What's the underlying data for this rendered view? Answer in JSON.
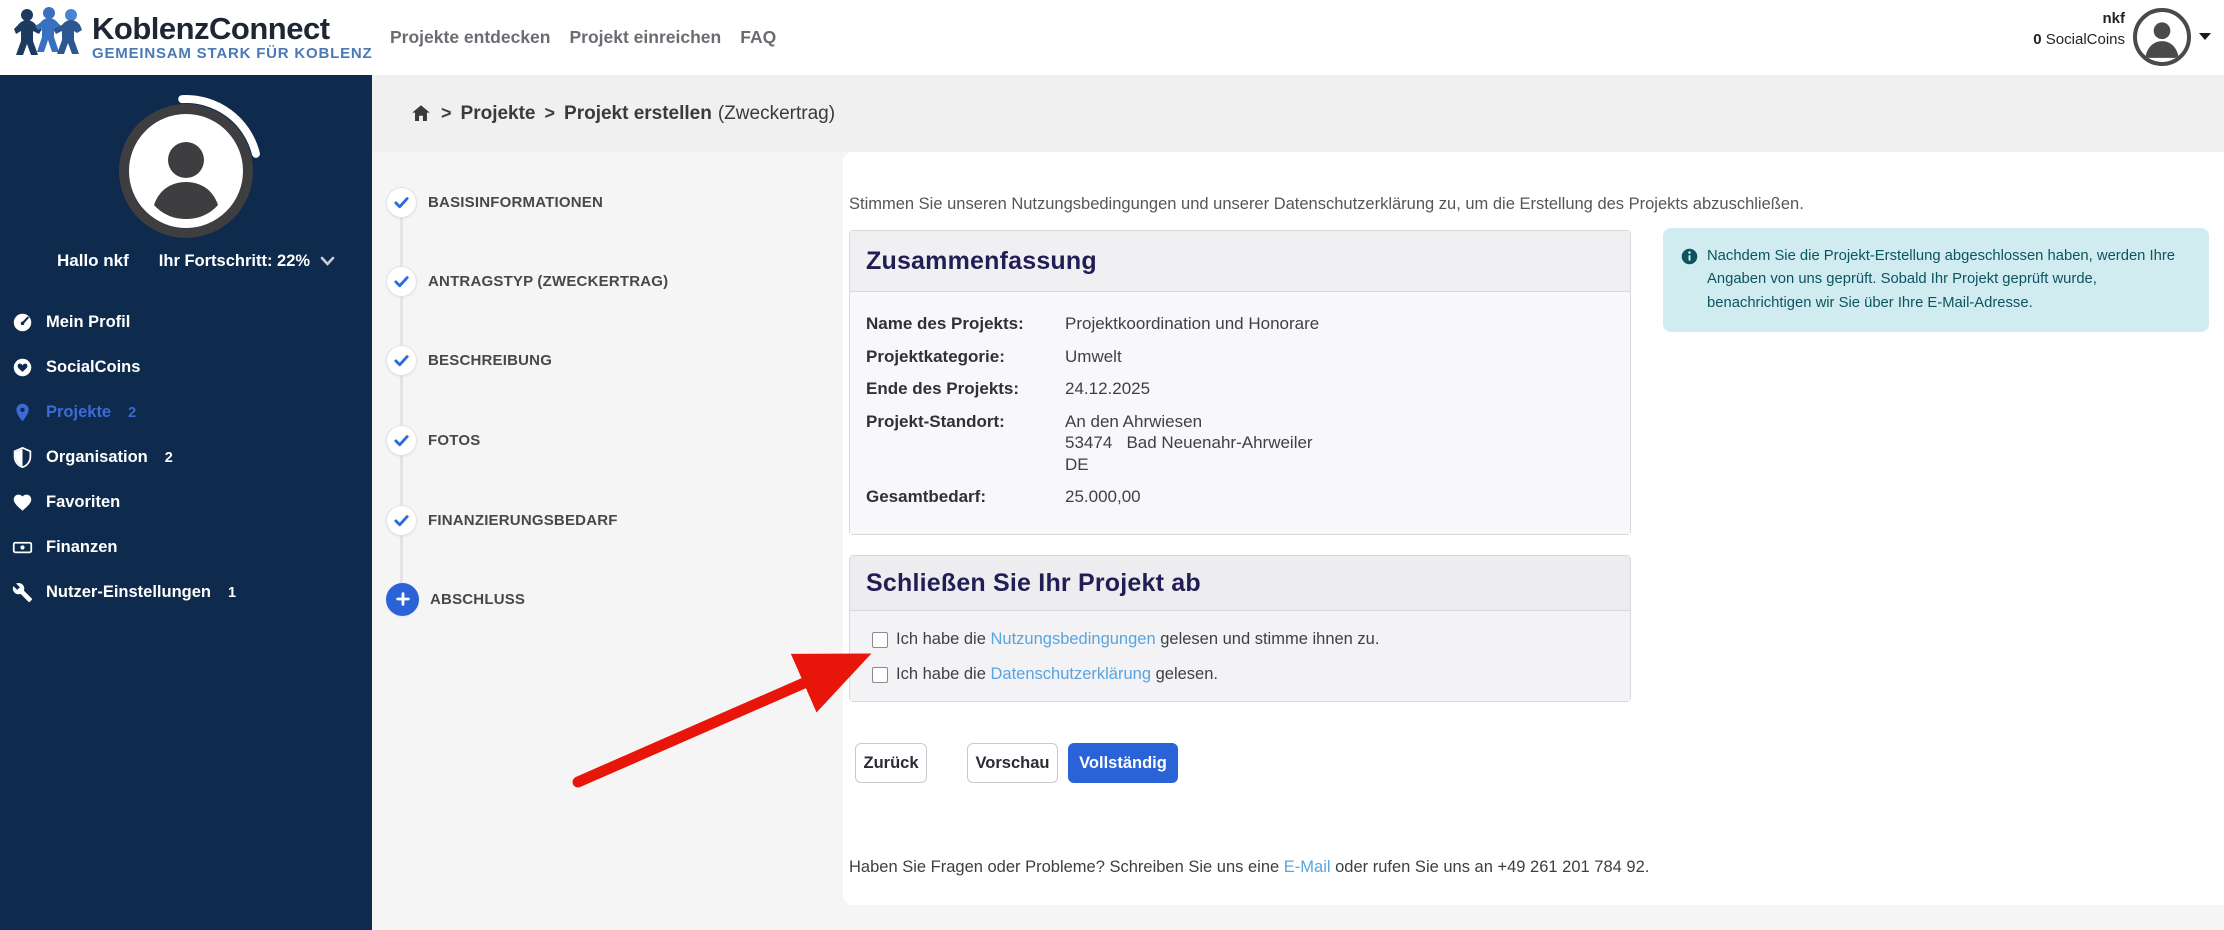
{
  "header": {
    "logo": {
      "title": "KoblenzConnect",
      "subtitle": "GEMEINSAM STARK FÜR KOBLENZ"
    },
    "nav": [
      {
        "label": "Projekte entdecken"
      },
      {
        "label": "Projekt einreichen"
      },
      {
        "label": "FAQ"
      }
    ],
    "user": {
      "name": "nkf",
      "coins_value": "0",
      "coins_label": " SocialCoins"
    }
  },
  "sidebar": {
    "greeting": "Hallo nkf",
    "progress_label": "Ihr Fortschritt: 22%",
    "items": [
      {
        "icon": "tachometer-icon",
        "label": "Mein Profil",
        "badge": ""
      },
      {
        "icon": "heart-circle-icon",
        "label": "SocialCoins",
        "badge": ""
      },
      {
        "icon": "map-pin-icon",
        "label": "Projekte",
        "badge": "2"
      },
      {
        "icon": "shield-icon",
        "label": "Organisation",
        "badge": "2"
      },
      {
        "icon": "heart-icon",
        "label": "Favoriten",
        "badge": ""
      },
      {
        "icon": "money-icon",
        "label": "Finanzen",
        "badge": ""
      },
      {
        "icon": "wrench-icon",
        "label": "Nutzer-Einstellungen",
        "badge": "1"
      }
    ]
  },
  "breadcrumb": {
    "sep": ">",
    "parent": "Projekte",
    "current": "Projekt erstellen",
    "suffix": "(Zweckertrag)"
  },
  "stepper": {
    "steps": [
      {
        "label": "BASISINFORMATIONEN",
        "state": "done"
      },
      {
        "label": "ANTRAGSTYP (ZWECKERTRAG)",
        "state": "done"
      },
      {
        "label": "BESCHREIBUNG",
        "state": "done"
      },
      {
        "label": "FOTOS",
        "state": "done"
      },
      {
        "label": "FINANZIERUNGSBEDARF",
        "state": "done"
      },
      {
        "label": "ABSCHLUSS",
        "state": "current"
      }
    ]
  },
  "main": {
    "intro": "Stimmen Sie unseren Nutzungsbedingungen und unserer Datenschutzerklärung zu, um die Erstellung des Projekts abzuschließen.",
    "summary": {
      "title": "Zusammenfassung",
      "rows": [
        {
          "label": "Name des Projekts:",
          "value": "Projektkoordination und Honorare"
        },
        {
          "label": "Projektkategorie:",
          "value": "Umwelt"
        },
        {
          "label": "Ende des Projekts:",
          "value": "24.12.2025"
        },
        {
          "label": "Projekt-Standort:",
          "value": "An den Ahrwiesen\n53474   Bad Neuenahr-Ahrweiler\nDE"
        },
        {
          "label": "Gesamtbedarf:",
          "value": "25.000,00"
        }
      ]
    },
    "finish": {
      "title": "Schließen Sie Ihr Projekt ab",
      "checkboxes": [
        {
          "pre": "Ich habe die ",
          "link": "Nutzungsbedingungen",
          "post": " gelesen und stimme ihnen zu."
        },
        {
          "pre": "Ich habe die ",
          "link": "Datenschutzerklärung",
          "post": " gelesen."
        }
      ]
    },
    "buttons": {
      "back": "Zurück",
      "preview": "Vorschau",
      "complete": "Vollständig"
    },
    "info_box": "Nachdem Sie die Projekt-Erstellung abgeschlossen haben, werden Ihre Angaben von uns geprüft. Sobald Ihr Projekt geprüft wurde, benachrichtigen wir Sie über Ihre E-Mail-Adresse.",
    "help": {
      "pre": "Haben Sie Fragen oder Probleme? Schreiben Sie uns eine ",
      "link": "E-Mail",
      "post": " oder rufen Sie uns an +49 261 201 784 92."
    }
  },
  "colors": {
    "sidebar_navy": "#0e2a4d",
    "accent_blue": "#2a63d8",
    "active_item_blue": "#3d6bd5",
    "link_blue": "#58a4df",
    "info_bg": "#d1ecf1",
    "info_text": "#0c5460",
    "arrow_red": "#e8150b"
  }
}
